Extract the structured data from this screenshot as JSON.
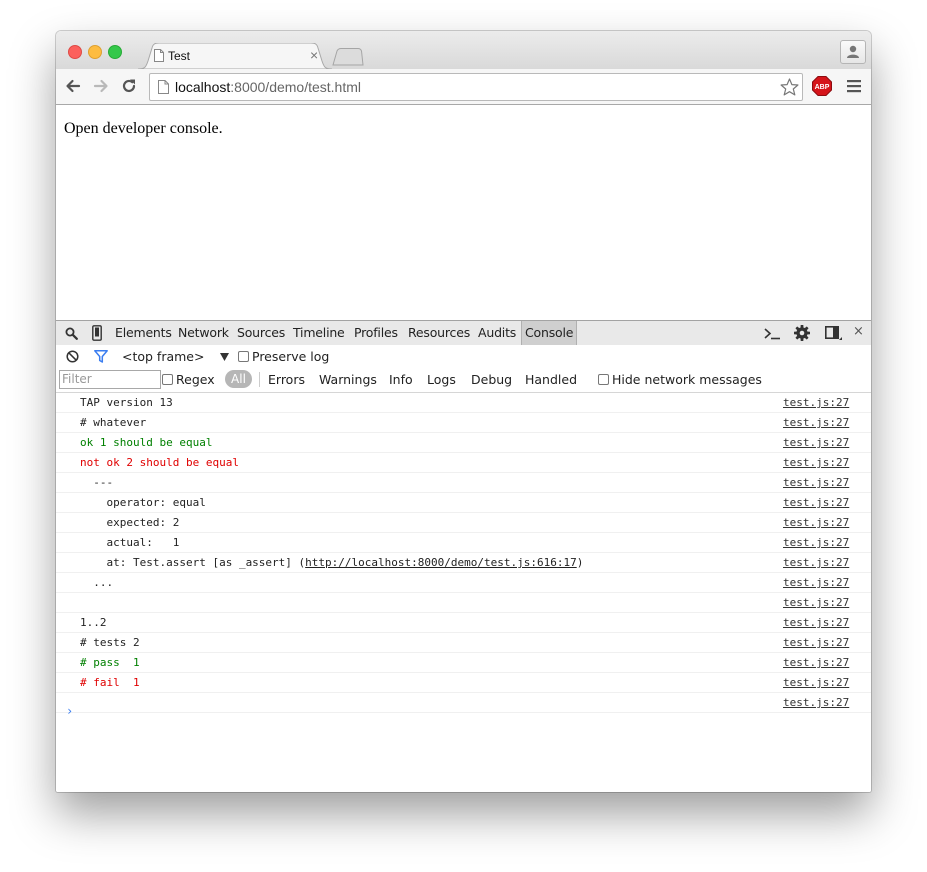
{
  "browser": {
    "tab_title": "Test",
    "tab_close": "×",
    "url_host": "localhost",
    "url_rest": ":8000/demo/test.html"
  },
  "page": {
    "text": "Open developer console."
  },
  "devtools": {
    "tabs": [
      "Elements",
      "Network",
      "Sources",
      "Timeline",
      "Profiles",
      "Resources",
      "Audits",
      "Console"
    ],
    "close": "×",
    "frame_select": "<top frame>",
    "preserve_log": "Preserve log",
    "filter_placeholder": "Filter",
    "regex": "Regex",
    "levels": [
      "All",
      "Errors",
      "Warnings",
      "Info",
      "Logs",
      "Debug",
      "Handled"
    ],
    "hide_network": "Hide network messages"
  },
  "console": {
    "source": "test.js:27",
    "lines": [
      {
        "text": "TAP version 13",
        "kind": "normal"
      },
      {
        "text": "# whatever",
        "kind": "normal"
      },
      {
        "text": "ok 1 should be equal",
        "kind": "green"
      },
      {
        "text": "not ok 2 should be equal",
        "kind": "red"
      },
      {
        "text": "  ---",
        "kind": "normal"
      },
      {
        "text": "    operator: equal",
        "kind": "normal"
      },
      {
        "text": "    expected: 2",
        "kind": "normal"
      },
      {
        "text": "    actual:   1",
        "kind": "normal"
      },
      {
        "text": "    at: Test.assert [as _assert] (",
        "link": "http://localhost:8000/demo/test.js:616:17",
        "after": ")",
        "kind": "normal"
      },
      {
        "text": "  ...",
        "kind": "normal"
      },
      {
        "text": "",
        "kind": "normal"
      },
      {
        "text": "1..2",
        "kind": "normal"
      },
      {
        "text": "# tests 2",
        "kind": "normal"
      },
      {
        "text": "# pass  1",
        "kind": "green"
      },
      {
        "text": "# fail  1",
        "kind": "red"
      },
      {
        "text": "",
        "kind": "normal"
      }
    ],
    "prompt": "›"
  },
  "colors": {
    "pass": "#008000",
    "fail": "#e00000",
    "prompt": "#3a7df0"
  }
}
